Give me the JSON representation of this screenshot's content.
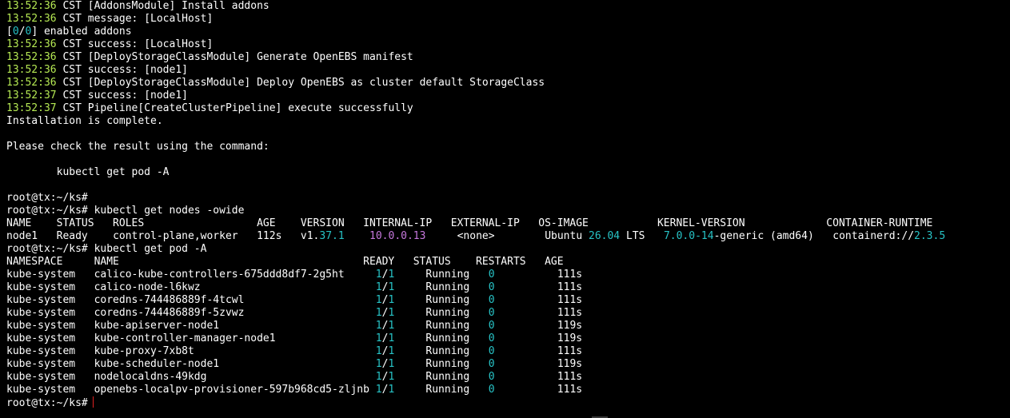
{
  "log_lines": [
    {
      "time": "13:52:36",
      "text": "CST [AddonsModule] Install addons"
    },
    {
      "time": "13:52:36",
      "text": "CST message: [LocalHost]"
    },
    {
      "enabled_prefix": "[",
      "enabled_n": "0",
      "enabled_sep": "/",
      "enabled_d": "0",
      "enabled_suffix": "] enabled addons"
    },
    {
      "time": "13:52:36",
      "text": "CST success: [LocalHost]"
    },
    {
      "time": "13:52:36",
      "text": "CST [DeployStorageClassModule] Generate OpenEBS manifest"
    },
    {
      "time": "13:52:36",
      "text": "CST success: [node1]"
    },
    {
      "time": "13:52:36",
      "text": "CST [DeployStorageClassModule] Deploy OpenEBS as cluster default StorageClass"
    },
    {
      "time": "13:52:37",
      "text": "CST success: [node1]"
    },
    {
      "time": "13:52:37",
      "text": "CST Pipeline[CreateClusterPipeline] execute successfully"
    }
  ],
  "install_complete": "Installation is complete.",
  "check_msg": "Please check the result using the command:",
  "check_cmd": "        kubectl get pod -A",
  "prompt": "root@tx:~/ks#",
  "cmd_nodes": " kubectl get nodes -owide",
  "cmd_pods": " kubectl get pod -A",
  "nodes_table": {
    "header": "NAME    STATUS   ROLES                  AGE    VERSION   INTERNAL-IP   EXTERNAL-IP   OS-IMAGE           KERNEL-VERSION             CONTAINER-RUNTIME",
    "row": {
      "name": "node1",
      "status": "Ready",
      "roles": "control-plane,worker",
      "age": "112s",
      "version_prefix": "v1.",
      "version_num": "37.1",
      "internal_ip": "10.0.0.13",
      "external_ip": "<none>",
      "os_name": "Ubuntu ",
      "os_num": "26.04",
      "os_suffix": " LTS",
      "kernel_num": "7.0.0-14",
      "kernel_suffix": "-generic (amd64)",
      "runtime_prefix": "containerd://",
      "runtime_num": "2.3.5"
    }
  },
  "pods_table": {
    "header": "NAMESPACE     NAME                                       READY   STATUS    RESTARTS   AGE",
    "rows": [
      {
        "ns": "kube-system",
        "name": "calico-kube-controllers-675ddd8df7-2g5ht",
        "ready_a": "1",
        "ready_sep": "/",
        "ready_b": "1",
        "status": "Running",
        "restarts": "0",
        "age": "111s"
      },
      {
        "ns": "kube-system",
        "name": "calico-node-l6kwz",
        "ready_a": "1",
        "ready_sep": "/",
        "ready_b": "1",
        "status": "Running",
        "restarts": "0",
        "age": "111s"
      },
      {
        "ns": "kube-system",
        "name": "coredns-744486889f-4tcwl",
        "ready_a": "1",
        "ready_sep": "/",
        "ready_b": "1",
        "status": "Running",
        "restarts": "0",
        "age": "111s"
      },
      {
        "ns": "kube-system",
        "name": "coredns-744486889f-5zvwz",
        "ready_a": "1",
        "ready_sep": "/",
        "ready_b": "1",
        "status": "Running",
        "restarts": "0",
        "age": "111s"
      },
      {
        "ns": "kube-system",
        "name": "kube-apiserver-node1",
        "ready_a": "1",
        "ready_sep": "/",
        "ready_b": "1",
        "status": "Running",
        "restarts": "0",
        "age": "119s"
      },
      {
        "ns": "kube-system",
        "name": "kube-controller-manager-node1",
        "ready_a": "1",
        "ready_sep": "/",
        "ready_b": "1",
        "status": "Running",
        "restarts": "0",
        "age": "119s"
      },
      {
        "ns": "kube-system",
        "name": "kube-proxy-7xb8t",
        "ready_a": "1",
        "ready_sep": "/",
        "ready_b": "1",
        "status": "Running",
        "restarts": "0",
        "age": "111s"
      },
      {
        "ns": "kube-system",
        "name": "kube-scheduler-node1",
        "ready_a": "1",
        "ready_sep": "/",
        "ready_b": "1",
        "status": "Running",
        "restarts": "0",
        "age": "119s"
      },
      {
        "ns": "kube-system",
        "name": "nodelocaldns-49kdg",
        "ready_a": "1",
        "ready_sep": "/",
        "ready_b": "1",
        "status": "Running",
        "restarts": "0",
        "age": "111s"
      },
      {
        "ns": "kube-system",
        "name": "openebs-localpv-provisioner-597b968cd5-zljnb",
        "ready_a": "1",
        "ready_sep": "/",
        "ready_b": "1",
        "status": "Running",
        "restarts": "0",
        "age": "111s"
      }
    ]
  },
  "colors": {
    "background": "#000000",
    "text": "#ffffff",
    "timestamp": "#b5e853",
    "number": "#27c3c6",
    "ip": "#c678dd",
    "cursor": "#e02020"
  }
}
